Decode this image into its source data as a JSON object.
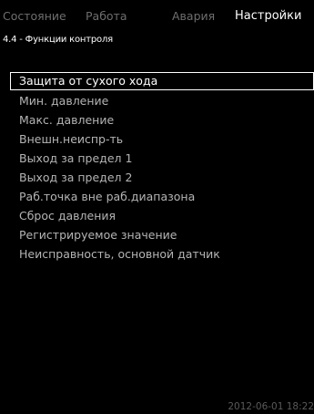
{
  "tabs": [
    {
      "label": "Состояние",
      "active": false
    },
    {
      "label": "Работа",
      "active": false
    },
    {
      "label": "Авария",
      "active": false
    },
    {
      "label": "Настройки",
      "active": true
    }
  ],
  "breadcrumb": "4.4 - Функции контроля",
  "menu": {
    "selected_index": 0,
    "items": [
      {
        "label": "Защита от сухого хода"
      },
      {
        "label": "Мин. давление"
      },
      {
        "label": "Макс. давление"
      },
      {
        "label": "Внешн.неиспр-ть"
      },
      {
        "label": "Выход за предел 1"
      },
      {
        "label": "Выход за предел 2"
      },
      {
        "label": "Раб.точка вне раб.диапазона"
      },
      {
        "label": "Сброс давления"
      },
      {
        "label": "Регистрируемое значение"
      },
      {
        "label": "Неисправность, основной датчик"
      }
    ]
  },
  "status": {
    "datetime": "2012-06-01 18:22"
  },
  "colors": {
    "background": "#000000",
    "active_tab": "#ffffff",
    "inactive_tab": "#6e6e6e",
    "menu_text": "#b4b4b4",
    "selected_border": "#ffffff"
  }
}
